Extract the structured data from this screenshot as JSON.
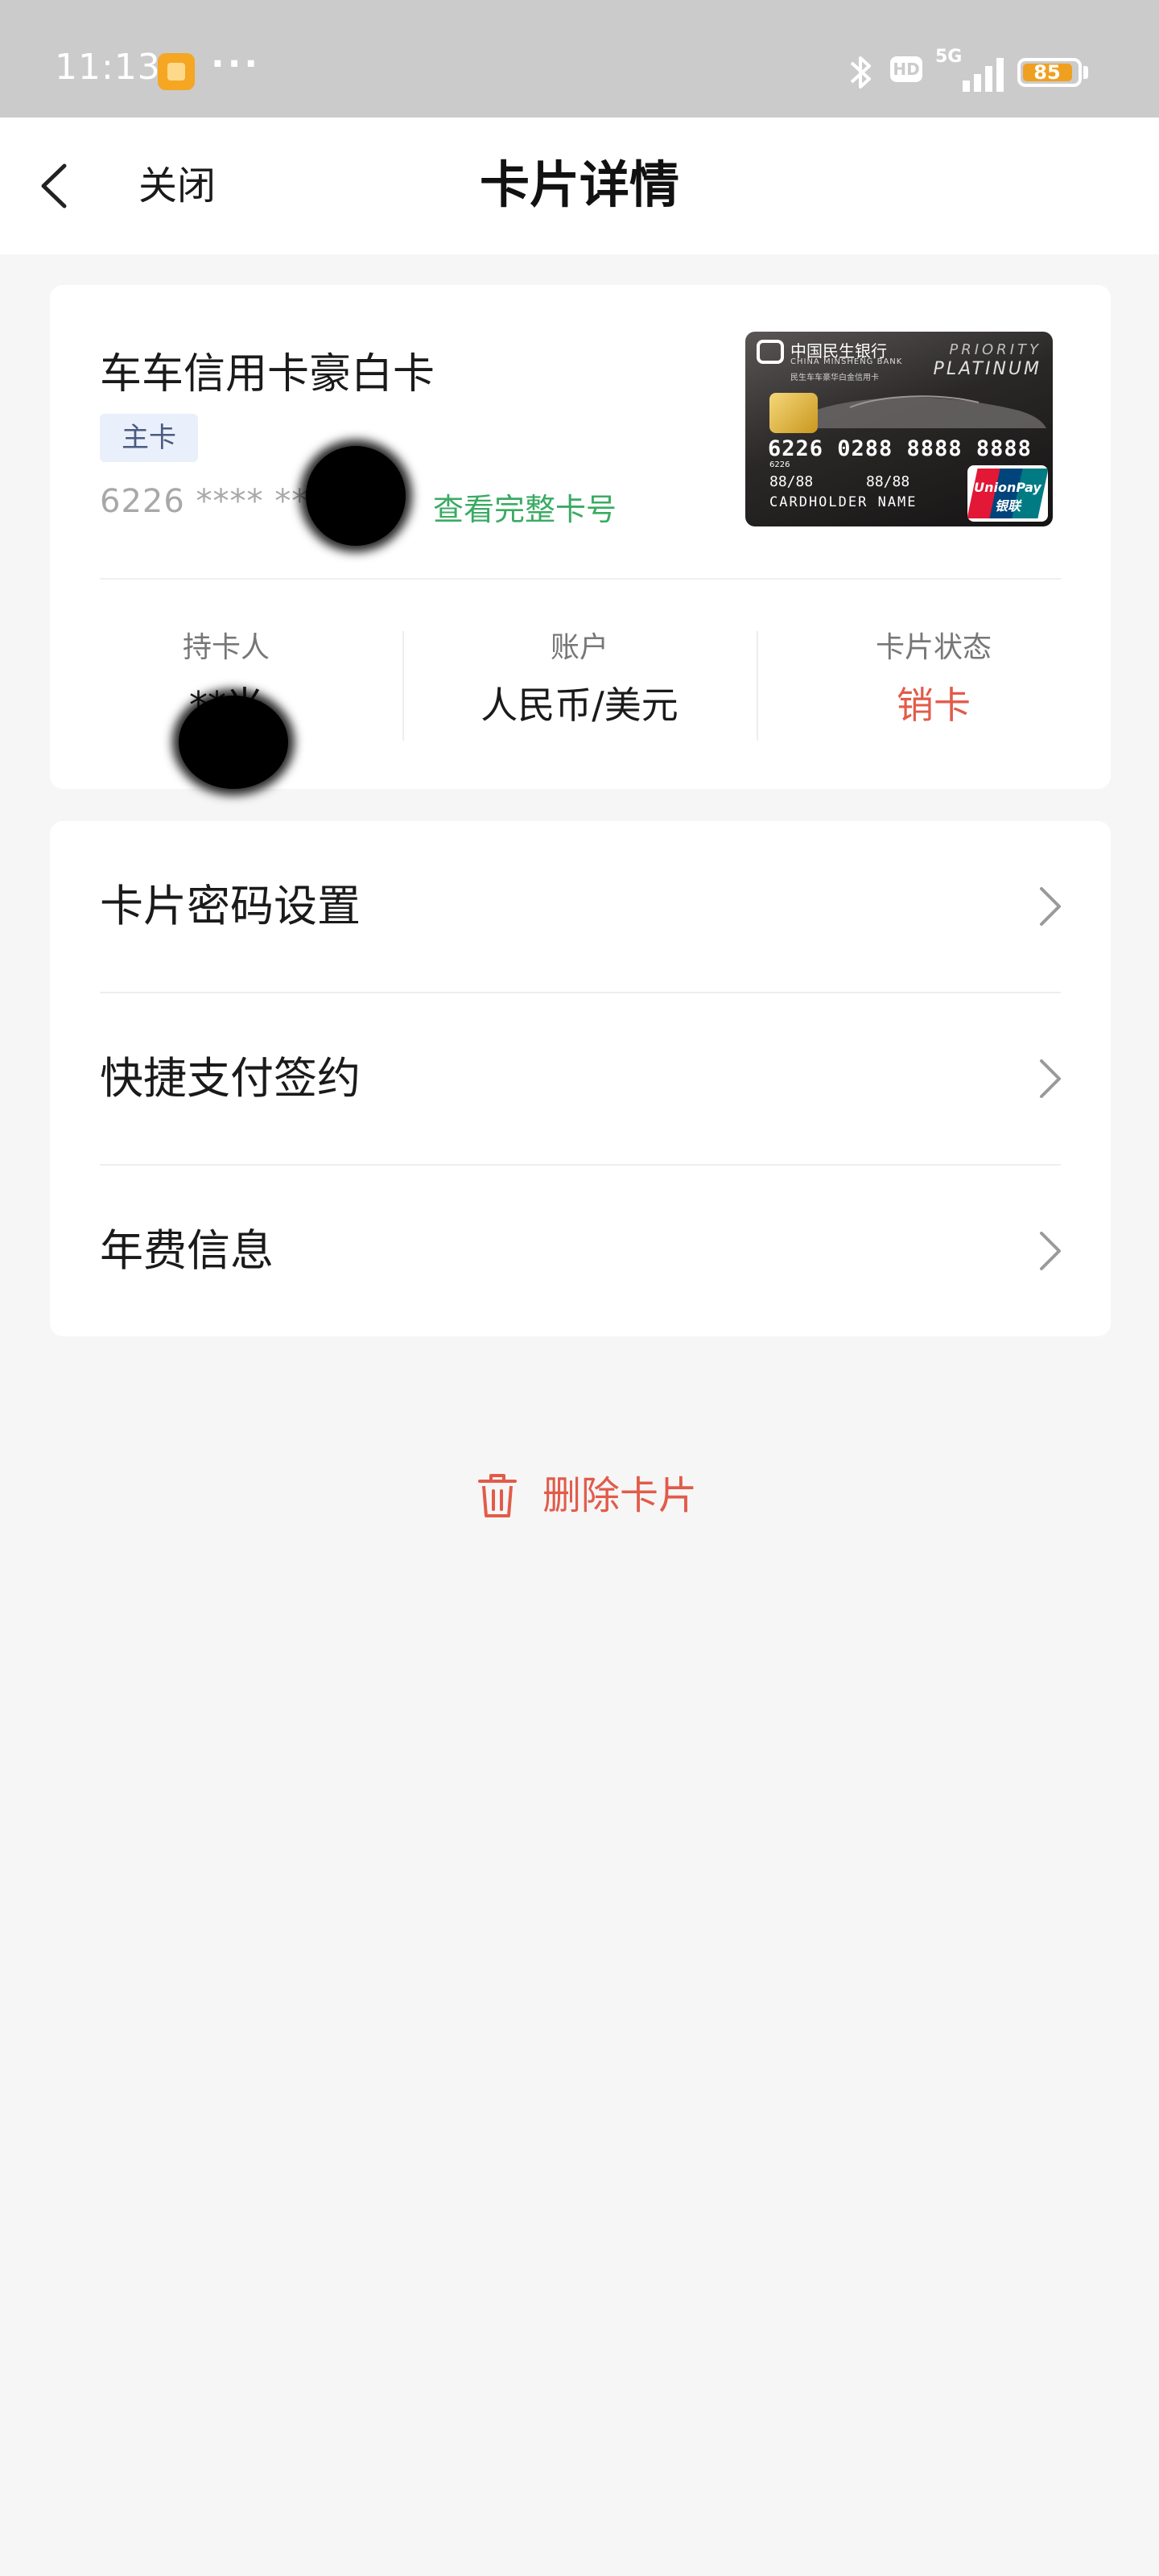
{
  "status_bar": {
    "time": "11:13",
    "more": "···",
    "network": "5G",
    "hd": "HD",
    "battery": "85",
    "battery_level": 0.85
  },
  "nav": {
    "close_label": "关闭",
    "title": "卡片详情"
  },
  "card": {
    "name": "车车信用卡豪白卡",
    "tag": "主卡",
    "masked_number": "6226 **** ***",
    "view_full_label": "查看完整卡号",
    "image": {
      "bank_cn": "中国民生银行",
      "bank_en": "CHINA MINSHENG BANK",
      "subtitle": "民生车车豪华白金信用卡",
      "priority": "PRIORITY",
      "platinum": "PLATINUM",
      "number": "6226 0288 8888 8888",
      "small_number": "6226",
      "valid_from": "88/88",
      "valid_thru": "88/88",
      "holder": "CARDHOLDER NAME",
      "network": "UnionPay 银联"
    },
    "info": {
      "holder_label": "持卡人",
      "holder_value": "**米",
      "account_label": "账户",
      "account_value": "人民币/美元",
      "status_label": "卡片状态",
      "status_value": "销卡"
    }
  },
  "menu": {
    "items": [
      {
        "label": "卡片密码设置"
      },
      {
        "label": "快捷支付签约"
      },
      {
        "label": "年费信息"
      }
    ]
  },
  "actions": {
    "delete_label": "删除卡片"
  },
  "colors": {
    "accent_green": "#3aab63",
    "status_red": "#e25b4a",
    "tag_bg": "#eaf0fb",
    "page_bg": "#f6f6f6"
  }
}
